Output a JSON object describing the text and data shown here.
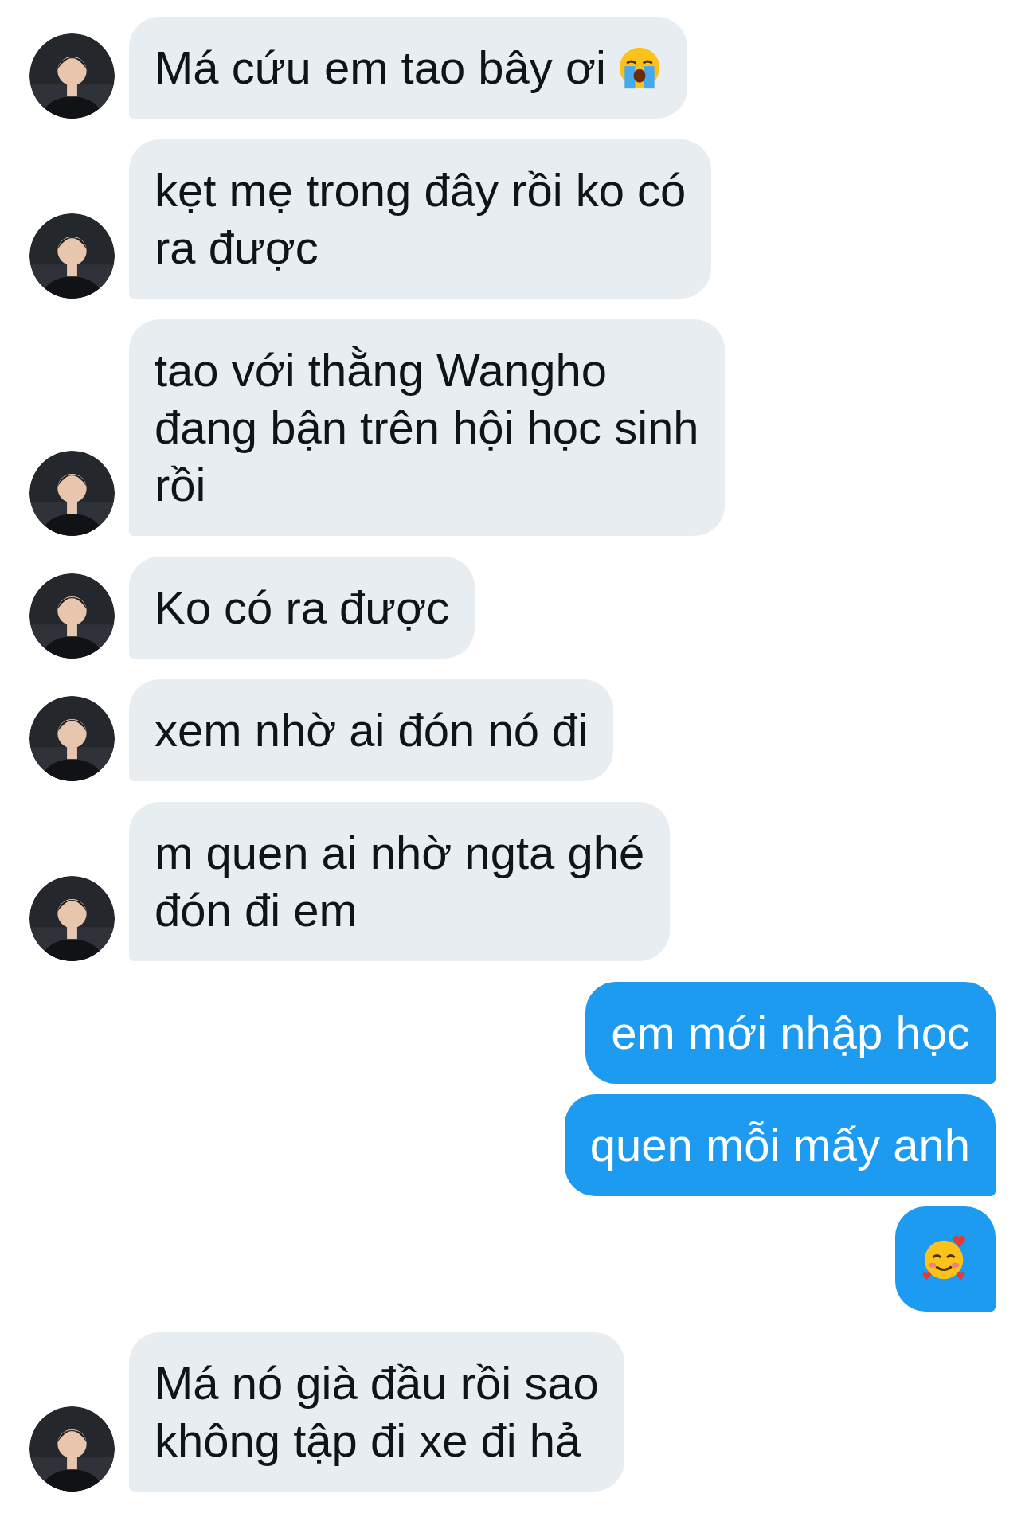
{
  "messages": [
    {
      "outgoing": false,
      "kind": "text_with_emoji",
      "lines": [
        "Má cứu em tao bây ơi"
      ]
    },
    {
      "outgoing": false,
      "kind": "text",
      "lines": [
        "kẹt mẹ trong đây rồi ko có",
        "ra được"
      ]
    },
    {
      "outgoing": false,
      "kind": "text",
      "lines": [
        "tao với thằng Wangho",
        "đang bận trên hội học sinh",
        "rồi"
      ]
    },
    {
      "outgoing": false,
      "kind": "text",
      "lines": [
        "Ko có ra được"
      ]
    },
    {
      "outgoing": false,
      "kind": "text",
      "lines": [
        "xem nhờ ai đón nó đi"
      ]
    },
    {
      "outgoing": false,
      "kind": "text",
      "lines": [
        "m quen ai nhờ ngta ghé",
        "đón đi em"
      ]
    },
    {
      "outgoing": true,
      "kind": "text",
      "lines": [
        "em mới nhập học"
      ]
    },
    {
      "outgoing": true,
      "kind": "text",
      "lines": [
        "quen mỗi mấy anh"
      ]
    },
    {
      "outgoing": true,
      "kind": "emoji"
    },
    {
      "outgoing": false,
      "kind": "text",
      "lines": [
        "Má nó già đầu rồi sao",
        "không tập đi xe đi hả"
      ]
    }
  ]
}
